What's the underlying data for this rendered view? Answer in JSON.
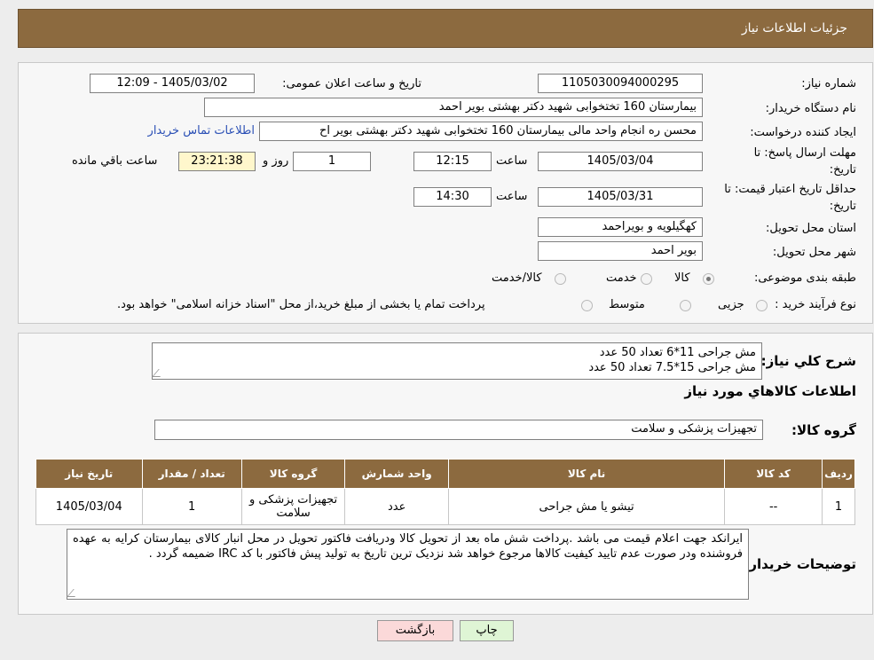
{
  "header": {
    "title": "جزئیات اطلاعات نیاز"
  },
  "form": {
    "need_number_label": "شماره نیاز:",
    "need_number": "1105030094000295",
    "announce_label": "تاریخ و ساعت اعلان عمومی:",
    "announce_value": "1405/03/02 - 12:09",
    "buyer_org_label": "نام دستگاه خریدار:",
    "buyer_org": "بیمارستان 160 تختخوابی شهید دکتر بهشتی بویر احمد",
    "requester_label": "ایجاد کننده درخواست:",
    "requester": "محسن ره انجام واحد مالی بیمارستان 160 تختخوابی شهید دکتر بهشتی بویر اح",
    "contact_link": "اطلاعات تماس خریدار",
    "deadline_label_1": "مهلت ارسال پاسخ: تا",
    "deadline_label_2": "تاریخ:",
    "deadline_date": "1405/03/04",
    "time_label": "ساعت",
    "deadline_time": "12:15",
    "days_value": "1",
    "days_label": "روز و",
    "remaining_time": "23:21:38",
    "remaining_label": "ساعت باقي مانده",
    "validity_label_1": "حداقل تاریخ اعتبار قیمت: تا",
    "validity_label_2": "تاریخ:",
    "validity_date": "1405/03/31",
    "validity_time": "14:30",
    "province_label": "استان محل تحویل:",
    "province": "کهگیلویه و بویراحمد",
    "city_label": "شهر محل تحویل:",
    "city": "بویر احمد",
    "category_label": "طبقه بندی موضوعی:",
    "category_options": [
      "کالا",
      "خدمت",
      "کالا/خدمت"
    ],
    "process_label": "نوع فرآیند خرید :",
    "process_options": [
      "جزیی",
      "متوسط"
    ],
    "process_note": "پرداخت تمام یا بخشی از مبلغ خرید،از محل \"اسناد خزانه اسلامی\" خواهد بود."
  },
  "need": {
    "summary_label": "شرح کلي نياز:",
    "summary_text": "مش جراحی 11*6 تعداد 50 عدد\nمش جراحی 15*7.5 تعداد 50 عدد",
    "goods_info_title": "اطلاعات کالاهاي مورد نياز",
    "goods_group_label": "گروه کالا:",
    "goods_group": "تجهیزات پزشکی و سلامت"
  },
  "table": {
    "headers": [
      "ردیف",
      "کد کالا",
      "نام کالا",
      "واحد شمارش",
      "گروه کالا",
      "تعداد / مقدار",
      "تاریخ نیاز"
    ],
    "rows": [
      {
        "row": "1",
        "code": "--",
        "name": "تیشو یا مش جراحی",
        "unit": "عدد",
        "group": "تجهیزات پزشکی و سلامت",
        "qty": "1",
        "date": "1405/03/04"
      }
    ]
  },
  "buyer_notes": {
    "label": "توضیحات خریدار:",
    "text": "ایرانکد جهت اعلام قیمت می باشد .پرداخت شش ماه بعد از تحویل کالا ودریافت فاکتور تحویل در محل انبار کالای بیمارستان کرایه به عهده فروشنده ودر صورت عدم تایید کیفیت کالاها مرجوع خواهد شد نزدیک ترین تاریخ به تولید پیش فاکتور با کد IRC ضمیمه گردد ."
  },
  "buttons": {
    "print": "چاپ",
    "back": "بازگشت"
  },
  "colors": {
    "header_bg": "#8c6a3f",
    "link": "#2a4fb5",
    "timer_bg": "#fff7cc",
    "back_btn_bg": "#fbd9d9",
    "print_btn_bg": "#dff5d5"
  }
}
